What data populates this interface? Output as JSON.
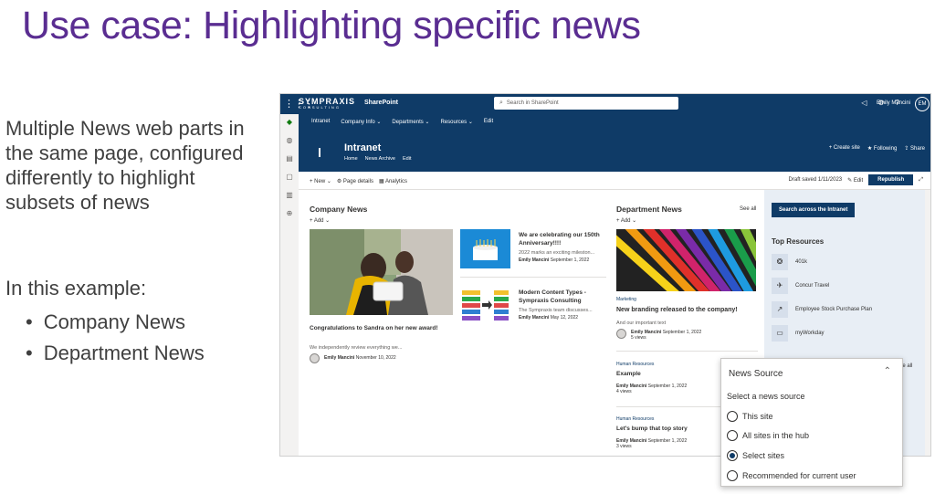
{
  "slide": {
    "title": "Use case: Highlighting specific news",
    "description": "Multiple News web parts in the same page, configured differently to highlight subsets of news",
    "example_heading": "In this example:",
    "bullets": [
      "Company News",
      "Department News"
    ]
  },
  "suitebar": {
    "logo": "SYMPRAXIS",
    "logo_sub": "CONSULTING",
    "app_name": "SharePoint",
    "search_placeholder": "Search in SharePoint",
    "user_name": "Emily Mancini",
    "user_initials": "EM"
  },
  "hubnav": {
    "items": [
      "Intranet",
      "Company Info ⌄",
      "Departments ⌄",
      "Resources ⌄",
      "Edit"
    ]
  },
  "site": {
    "title": "Intranet",
    "nav": [
      "Home",
      "News Archive",
      "Edit"
    ],
    "actions": [
      "+ Create site",
      "★ Following",
      "⇪ Share"
    ]
  },
  "commandbar": {
    "new": "+ New ⌄",
    "page_details": "⚙ Page details",
    "analytics": "▦ Analytics",
    "draft_saved": "Draft saved 1/11/2023",
    "edit": "✎ Edit",
    "republish": "Republish"
  },
  "company_news": {
    "title": "Company News",
    "add": "+ Add ⌄",
    "hero": {
      "title": "Congratulations to Sandra on her new award!",
      "desc": "We independently review everything we...",
      "author": "Emily Mancini",
      "date": "November 10, 2022"
    },
    "items": [
      {
        "title": "We are celebrating our 150th Anniversary!!!!",
        "desc": "2022 marks an exciting mileston...",
        "author": "Emily Mancini",
        "date": "September 1, 2022"
      },
      {
        "title": "Modern Content Types - Sympraxis Consulting",
        "desc": "The Sympraxis team discusses...",
        "author": "Emily Mancini",
        "date": "May 12, 2022"
      }
    ]
  },
  "department_news": {
    "title": "Department News",
    "see_all": "See all",
    "add": "+ Add ⌄",
    "hero": {
      "category": "Marketing",
      "title": "New branding released to the company!",
      "desc": "And our important text",
      "author": "Emily Mancini",
      "date": "September 1, 2022",
      "views": "5 views"
    },
    "items": [
      {
        "category": "Human Resources",
        "title": "Example",
        "author": "Emily Mancini",
        "date": "September 1, 2022",
        "views": "4 views"
      },
      {
        "category": "Human Resources",
        "title": "Let's bump that top story",
        "author": "Emily Mancini",
        "date": "September 1, 2022",
        "views": "3 views"
      }
    ]
  },
  "sidepanel": {
    "search_button": "Search across the Intranet",
    "top_resources_title": "Top Resources",
    "resources": [
      "401k",
      "Concur Travel",
      "Employee Stock Purchase Plan",
      "myWorkday"
    ],
    "see_all_peek": "ee all"
  },
  "news_source_popup": {
    "title": "News Source",
    "subtitle": "Select a news source",
    "options": [
      "This site",
      "All sites in the hub",
      "Select sites",
      "Recommended for current user"
    ],
    "selected": "Select sites"
  },
  "colors": {
    "title_purple": "#5a2d91",
    "suite_blue": "#0f3b67"
  }
}
